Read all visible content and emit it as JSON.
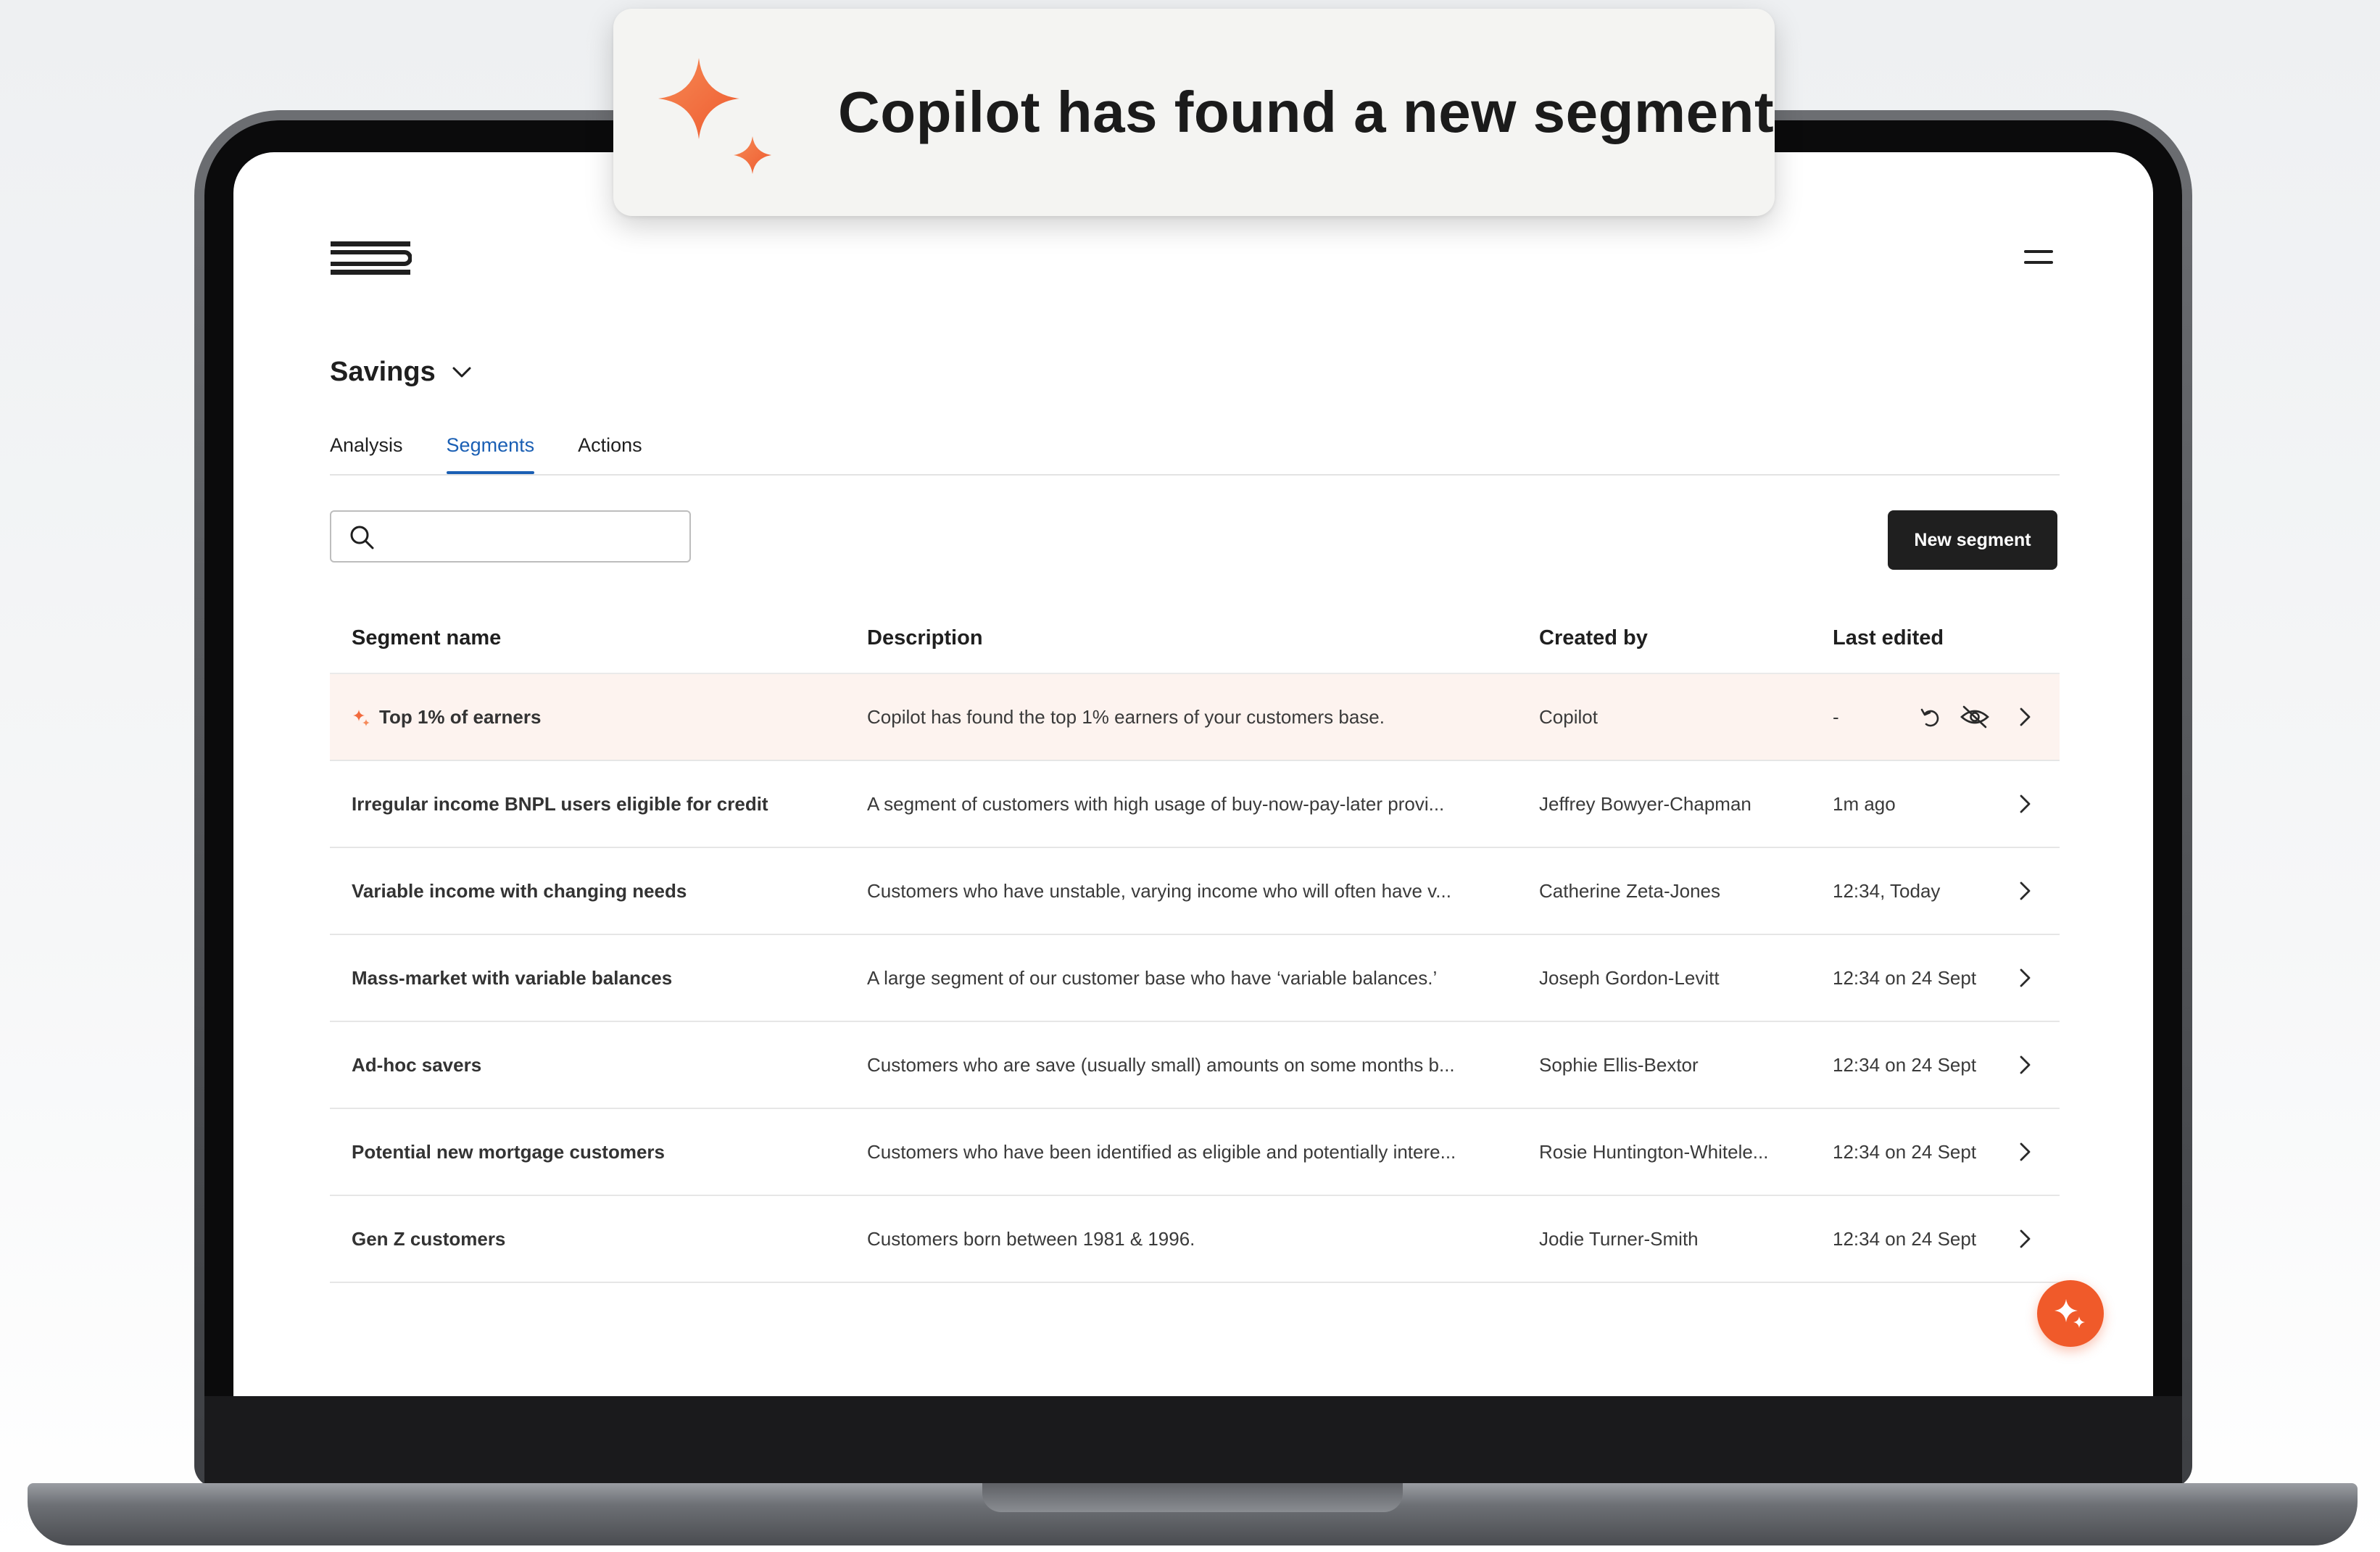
{
  "toast": {
    "message": "Copilot has found a new segment",
    "icon": "sparkle-icon"
  },
  "header": {
    "logo": "brand-logo-icon",
    "menu": "hamburger-menu-icon"
  },
  "product": {
    "title": "Savings",
    "icon": "chevron-down-icon"
  },
  "tabs": [
    {
      "label": "Analysis",
      "active": false
    },
    {
      "label": "Segments",
      "active": true
    },
    {
      "label": "Actions",
      "active": false
    }
  ],
  "search": {
    "placeholder": "",
    "value": ""
  },
  "new_segment_button": "New segment",
  "table": {
    "columns": [
      "Segment name",
      "Description",
      "Created by",
      "Last edited"
    ],
    "rows": [
      {
        "name": "Top 1% of earners",
        "description": "Copilot has found the top 1% earners of your customers base.",
        "created_by": "Copilot",
        "last_edited": "-",
        "copilot": true
      },
      {
        "name": "Irregular income BNPL users eligible for credit",
        "description": "A segment of customers with high usage of buy-now-pay-later provi...",
        "created_by": "Jeffrey Bowyer-Chapman",
        "last_edited": "1m ago"
      },
      {
        "name": "Variable income with changing needs",
        "description": "Customers who have unstable, varying income who will often have v...",
        "created_by": "Catherine Zeta-Jones",
        "last_edited": "12:34, Today"
      },
      {
        "name": "Mass-market with variable balances",
        "description": "A large segment of our customer base who have ‘variable balances.’",
        "created_by": "Joseph Gordon-Levitt",
        "last_edited": "12:34 on 24 Sept"
      },
      {
        "name": "Ad-hoc savers",
        "description": "Customers who are save (usually small) amounts on some months b...",
        "created_by": "Sophie Ellis-Bextor",
        "last_edited": "12:34 on 24 Sept"
      },
      {
        "name": "Potential new mortgage customers",
        "description": "Customers who have been identified as eligible and potentially intere...",
        "created_by": "Rosie Huntington-Whitele...",
        "last_edited": "12:34 on 24 Sept"
      },
      {
        "name": "Gen Z customers",
        "description": "Customers born between 1981 & 1996.",
        "created_by": "Jodie Turner-Smith",
        "last_edited": "12:34 on 24 Sept"
      }
    ]
  },
  "colors": {
    "accent": "#1a5fb4",
    "copilot_orange": "#f05a2a",
    "highlight_row": "#fdf3ef",
    "primary_button": "#1f1f1f"
  }
}
